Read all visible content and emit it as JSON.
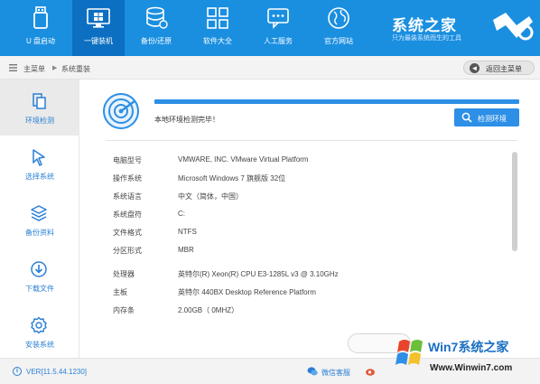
{
  "toolbar": {
    "items": [
      {
        "label": "U 盘启动",
        "icon": "usb-drive-icon"
      },
      {
        "label": "一键装机",
        "icon": "windows-icon"
      },
      {
        "label": "备份/还原",
        "icon": "database-icon"
      },
      {
        "label": "软件大全",
        "icon": "apps-grid-icon"
      },
      {
        "label": "人工服务",
        "icon": "chat-icon"
      },
      {
        "label": "官方网站",
        "icon": "globe-icon"
      }
    ],
    "active_index": 1
  },
  "brand": {
    "name": "系统之家",
    "subtitle": "只为最装系统而生的工具"
  },
  "breadcrumb": {
    "home": "主菜单",
    "separator": "▶",
    "current": "系统重装",
    "back_label": "返回主菜单"
  },
  "sidebar": {
    "items": [
      {
        "label": "环境检测",
        "icon": "environment-check-icon"
      },
      {
        "label": "选择系统",
        "icon": "cursor-icon"
      },
      {
        "label": "备份资料",
        "icon": "layers-icon"
      },
      {
        "label": "下载文件",
        "icon": "download-icon"
      },
      {
        "label": "安装系统",
        "icon": "gear-icon"
      }
    ],
    "active_index": 0
  },
  "main": {
    "progress_percent": 100,
    "check_message": "本地环境检测完毕！",
    "detect_button": "检测环境",
    "info_rows": [
      {
        "key": "电脑型号",
        "value": "VMWARE, INC. VMware Virtual Platform"
      },
      {
        "key": "操作系统",
        "value": "Microsoft Windows 7 旗舰版  32位"
      },
      {
        "key": "系统语言",
        "value": "中文（简体，中国）"
      },
      {
        "key": "系统盘符",
        "value": "C:"
      },
      {
        "key": "文件格式",
        "value": "NTFS"
      },
      {
        "key": "分区形式",
        "value": "MBR"
      },
      {
        "key": "处理器",
        "value": "英特尔(R) Xeon(R) CPU E3-1285L v3 @ 3.10GHz"
      },
      {
        "key": "主板",
        "value": "英特尔 440BX Desktop Reference Platform"
      },
      {
        "key": "内存条",
        "value": "2.00GB（ 0MHZ）"
      }
    ]
  },
  "statusbar": {
    "version": "VER[11.5.44.1230]",
    "wechat_label": "微信客服"
  },
  "watermark": {
    "title": "Win7系统之家",
    "url": "Www.Winwin7.com"
  },
  "colors": {
    "accent": "#1a8fe0",
    "toolbar_active": "#0c6fc2",
    "link": "#2a7fd4"
  }
}
